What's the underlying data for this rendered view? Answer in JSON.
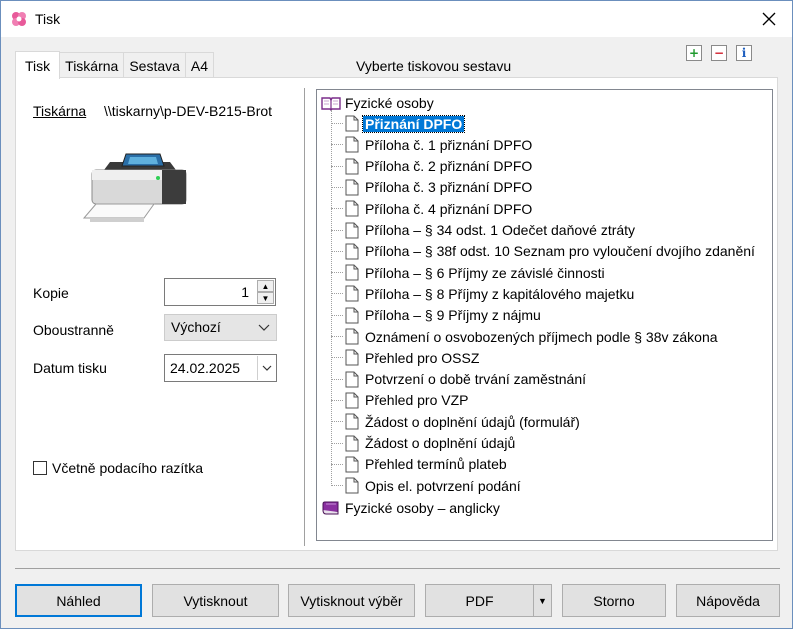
{
  "window": {
    "title": "Tisk",
    "close_icon": "close-icon"
  },
  "tabs": [
    {
      "label": "Tisk",
      "active": true
    },
    {
      "label": "Tiskárna",
      "active": false
    },
    {
      "label": "Sestava",
      "active": false
    },
    {
      "label": "A4",
      "active": false
    }
  ],
  "tree_header": "Vyberte tiskovou sestavu",
  "toolbar_icons": [
    "add-icon",
    "remove-icon",
    "info-icon"
  ],
  "form": {
    "printer_label": "Tiskárna",
    "printer_value": "\\\\tiskarny\\p-DEV-B215-Brot",
    "copies_label": "Kopie",
    "copies_value": "1",
    "duplex_label": "Oboustranně",
    "duplex_value": "Výchozí",
    "date_label": "Datum tisku",
    "date_value": "24.02.2025",
    "stamp_checkbox_label": "Včetně podacího razítka",
    "stamp_checked": false
  },
  "tree": {
    "root": {
      "label": "Fyzické osoby",
      "icon": "open-book-icon"
    },
    "items": [
      {
        "label": "Přiznání DPFO",
        "selected": true
      },
      {
        "label": "Příloha č. 1 přiznání DPFO"
      },
      {
        "label": "Příloha č. 2 přiznání DPFO"
      },
      {
        "label": "Příloha č. 3 přiznání DPFO"
      },
      {
        "label": "Příloha č. 4 přiznání DPFO"
      },
      {
        "label": "Příloha – § 34 odst. 1 Odečet daňové ztráty"
      },
      {
        "label": "Příloha – § 38f odst. 10 Seznam pro vyloučení dvojího zdanění"
      },
      {
        "label": "Příloha – § 6 Příjmy ze závislé činnosti"
      },
      {
        "label": "Příloha – § 8 Příjmy z kapitálového majetku"
      },
      {
        "label": "Příloha – § 9 Příjmy z nájmu"
      },
      {
        "label": "Oznámení o osvobozených příjmech podle § 38v zákona"
      },
      {
        "label": "Přehled pro OSSZ"
      },
      {
        "label": "Potvrzení o době trvání zaměstnání"
      },
      {
        "label": "Přehled pro VZP"
      },
      {
        "label": "Žádost o doplnění údajů (formulář)"
      },
      {
        "label": "Žádost o doplnění údajů"
      },
      {
        "label": "Přehled termínů plateb"
      },
      {
        "label": "Opis el. potvrzení podání"
      }
    ],
    "root2": {
      "label": "Fyzické osoby – anglicky",
      "icon": "closed-book-icon"
    }
  },
  "buttons": {
    "preview": "Náhled",
    "print": "Vytisknout",
    "print_selection": "Vytisknout výběr",
    "pdf": "PDF",
    "cancel": "Storno",
    "help": "Nápověda"
  },
  "colors": {
    "selection": "#0078d7",
    "book_open": "#7a2d8a",
    "book_closed": "#7a1f8a"
  }
}
